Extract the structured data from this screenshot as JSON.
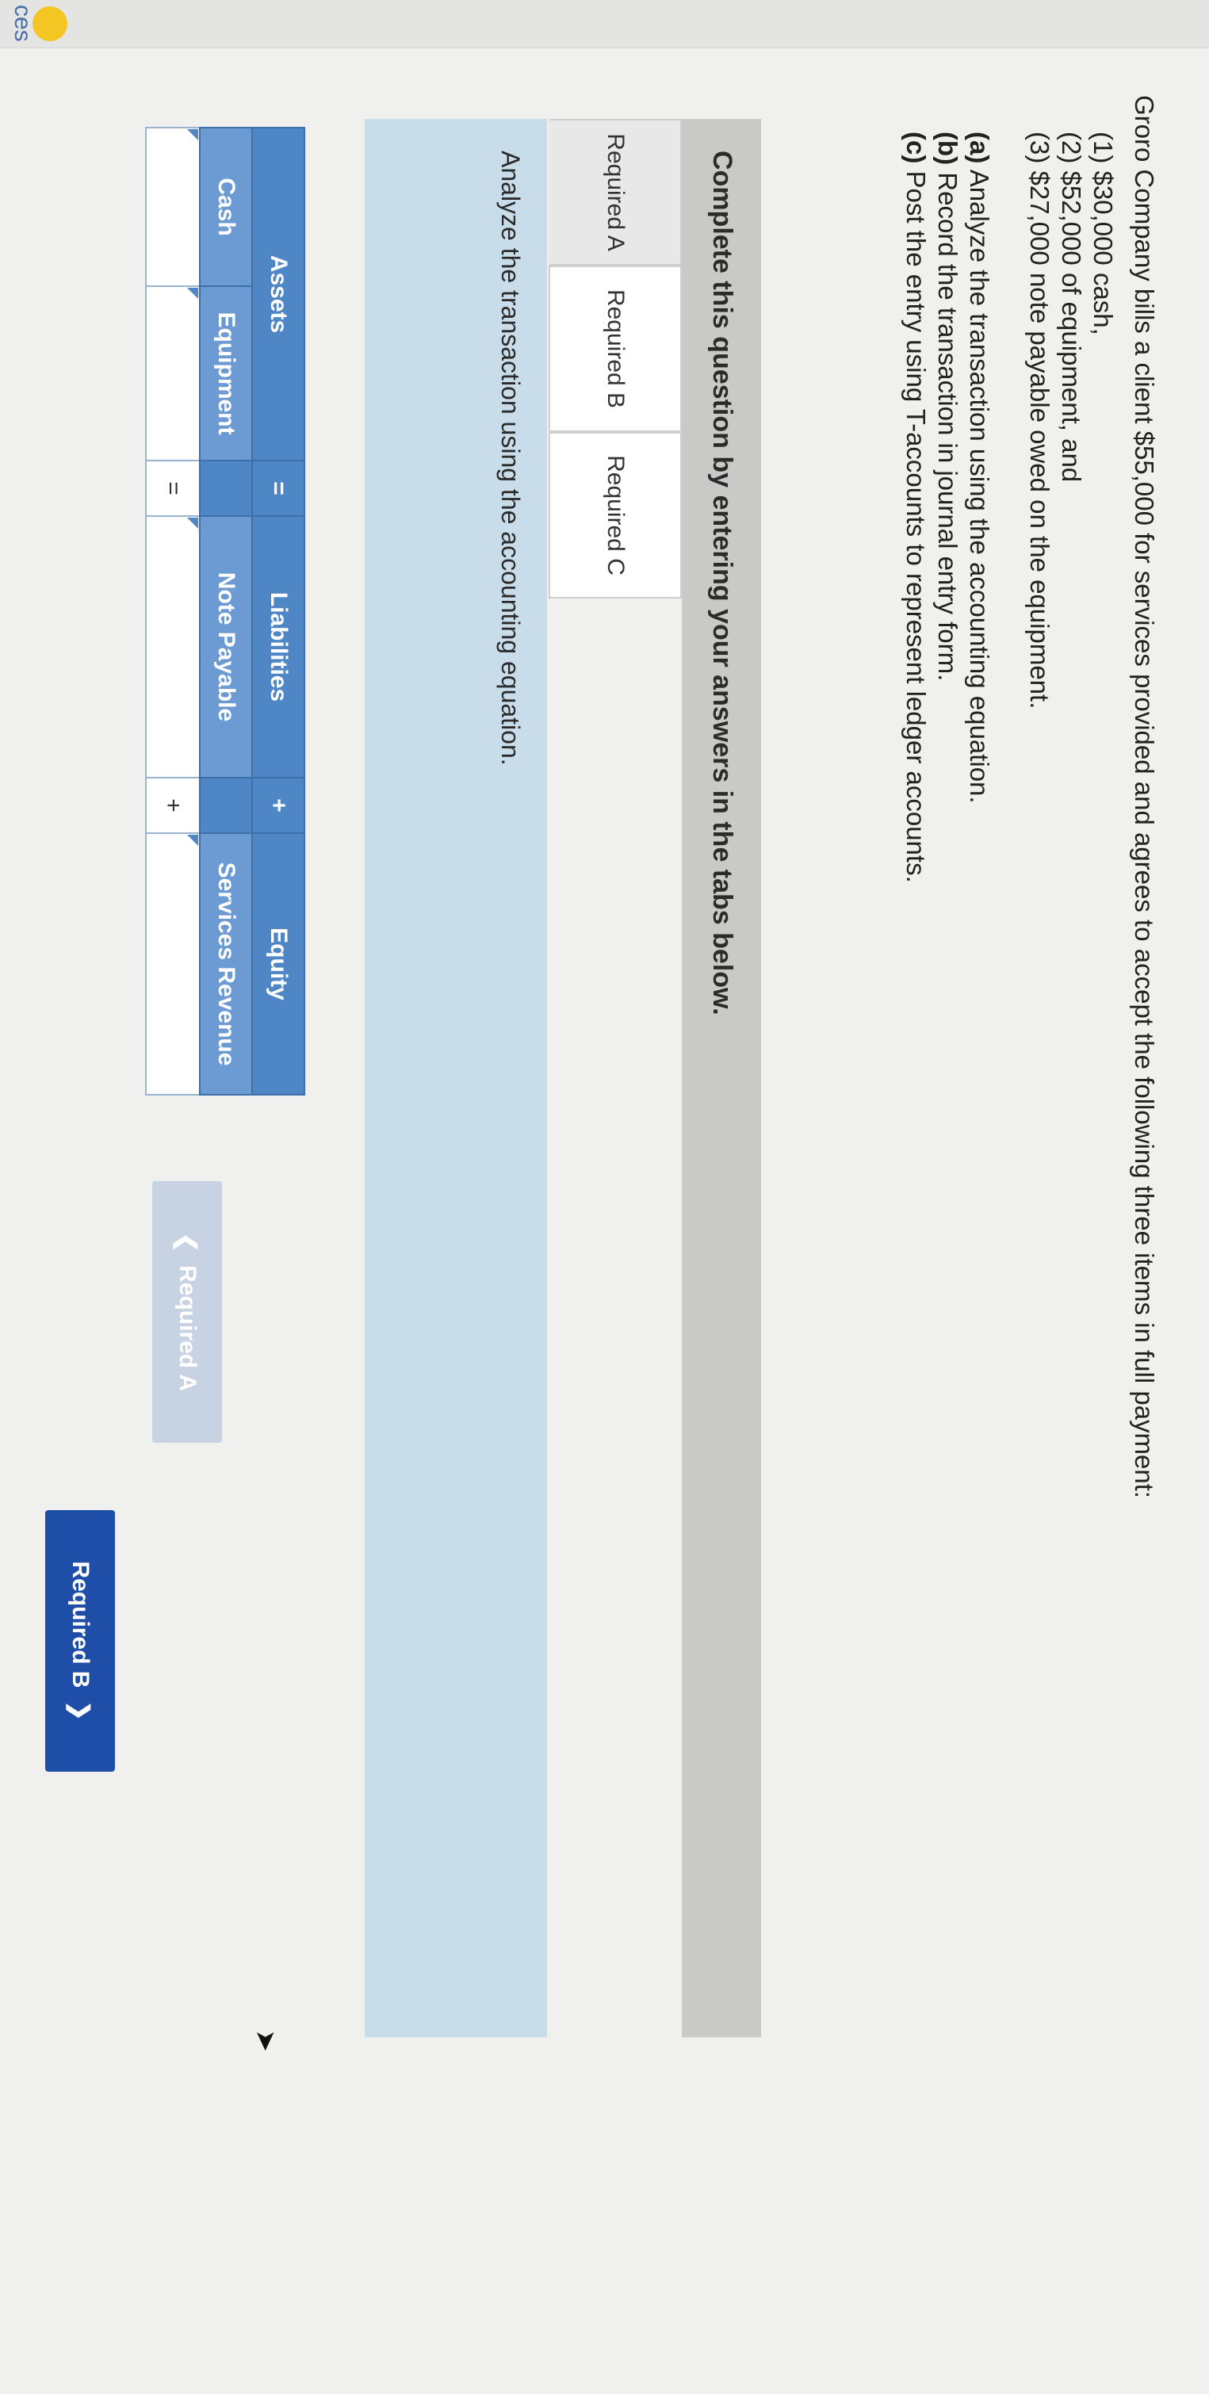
{
  "side": {
    "edge_label": "ces"
  },
  "problem": {
    "intro": "Groro Company bills a client $55,000 for services provided and agrees to accept the following three items in full payment:",
    "items": [
      "(1) $30,000 cash,",
      "(2) $52,000 of equipment, and",
      "(3) $27,000 note payable owed on the equipment."
    ],
    "requirements": [
      {
        "tag": "(a)",
        "text": " Analyze the transaction using the accounting equation."
      },
      {
        "tag": "(b)",
        "text": " Record the transaction in journal entry form."
      },
      {
        "tag": "(c)",
        "text": " Post the entry using T-accounts to represent ledger accounts."
      }
    ]
  },
  "banner": {
    "text": "Complete this question by entering your answers in the tabs below."
  },
  "tabs": [
    {
      "label": "Required A",
      "active": true
    },
    {
      "label": "Required B",
      "active": false
    },
    {
      "label": "Required C",
      "active": false
    }
  ],
  "panel": {
    "instruction": "Analyze the transaction using the accounting equation."
  },
  "equation": {
    "groups": {
      "assets": "Assets",
      "liabilities": "Liabilities",
      "equity": "Equity"
    },
    "operators": {
      "eq": "=",
      "plus": "+"
    },
    "columns": {
      "cash": "Cash",
      "equipment": "Equipment",
      "note_payable": "Note Payable",
      "services_revenue": "Services Revenue"
    },
    "values": {
      "cash": "",
      "equipment": "",
      "note_payable": "",
      "services_revenue": ""
    },
    "input_ops": {
      "plus1": "+",
      "eq": "=",
      "plus2": "+"
    }
  },
  "nav": {
    "prev_label": "Required A",
    "next_label": "Required B",
    "prev_icon": "chevron-left",
    "next_icon": "chevron-right"
  },
  "colors": {
    "header_blue": "#4f86c6",
    "next_button": "#1f4ea8",
    "panel_bg": "#c8dcea"
  }
}
